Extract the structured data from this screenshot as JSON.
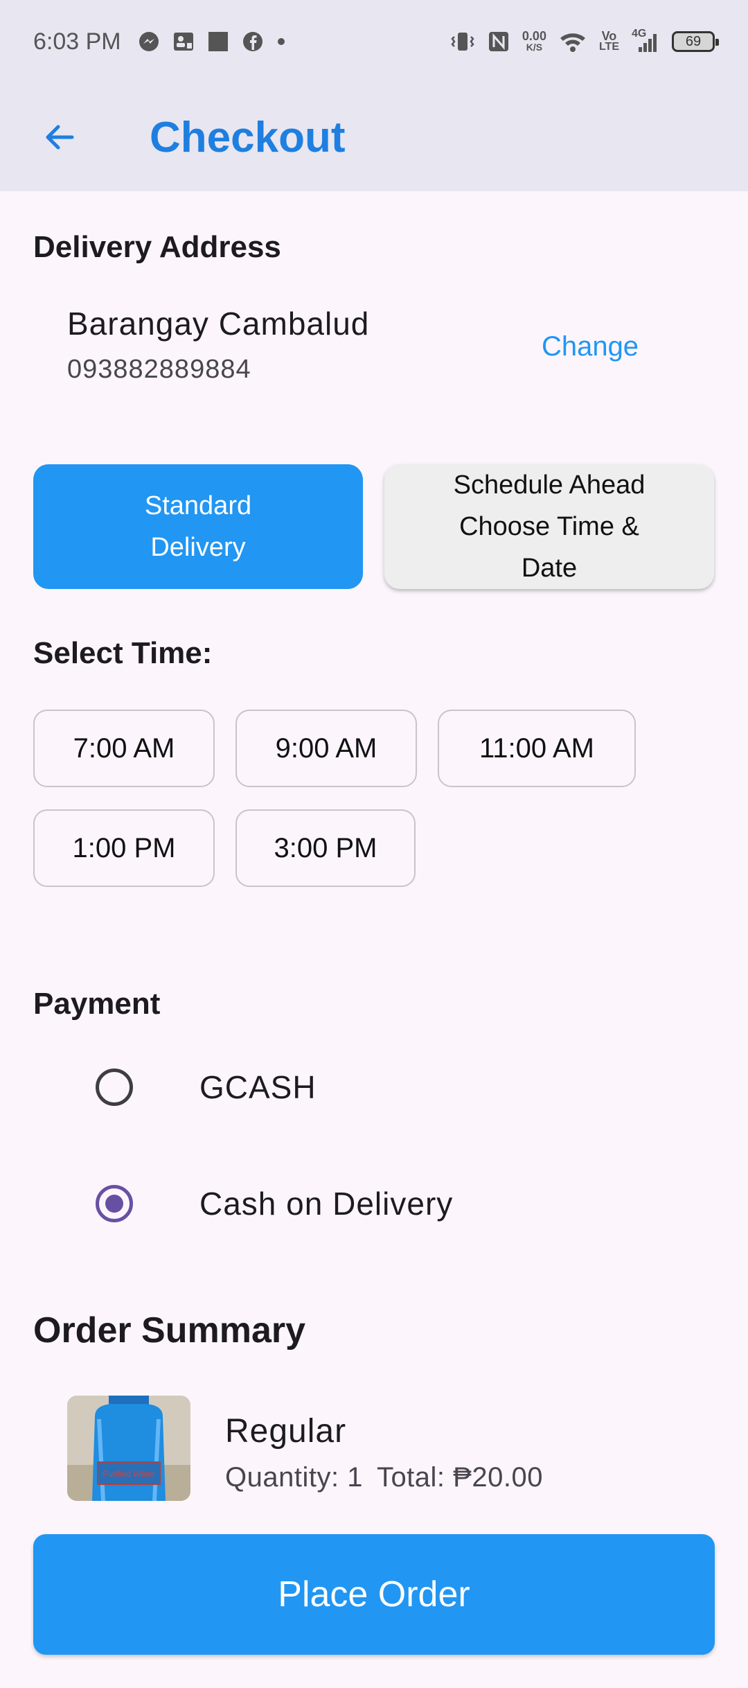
{
  "status_bar": {
    "time": "6:03 PM",
    "left_icons": [
      "messenger-icon",
      "contact-card-icon",
      "square-icon",
      "facebook-icon",
      "dot-icon"
    ],
    "network_speed_top": "0.00",
    "network_speed_bottom": "K/S",
    "volte_top": "Vo",
    "volte_bottom": "LTE",
    "signal_label": "4G",
    "battery": "69"
  },
  "app_bar": {
    "title": "Checkout"
  },
  "delivery_address": {
    "heading": "Delivery Address",
    "name": "Barangay Cambalud",
    "phone": "093882889884",
    "change_label": "Change"
  },
  "delivery_options": {
    "standard_line1": "Standard",
    "standard_line2": "Delivery",
    "schedule_line1": "Schedule Ahead",
    "schedule_line2": "Choose Time &",
    "schedule_line3": "Date"
  },
  "select_time": {
    "heading": "Select Time:",
    "slots": [
      "7:00 AM",
      "9:00 AM",
      "11:00 AM",
      "1:00 PM",
      "3:00 PM"
    ]
  },
  "payment": {
    "heading": "Payment",
    "options": [
      "GCASH",
      "Cash on Delivery"
    ],
    "selected": "Cash on Delivery"
  },
  "order_summary": {
    "heading": "Order Summary",
    "item_name": "Regular",
    "quantity": "Quantity: 1",
    "total": "Total: ₱20.00",
    "thumb_text": "Purified Water"
  },
  "actions": {
    "place_order": "Place Order"
  },
  "colors": {
    "accent": "#2196f3",
    "title_blue": "#1e7fe0",
    "radio_selected": "#6750a4",
    "app_bar_bg": "#e8e6f1",
    "page_bg": "#fcf6fc"
  }
}
